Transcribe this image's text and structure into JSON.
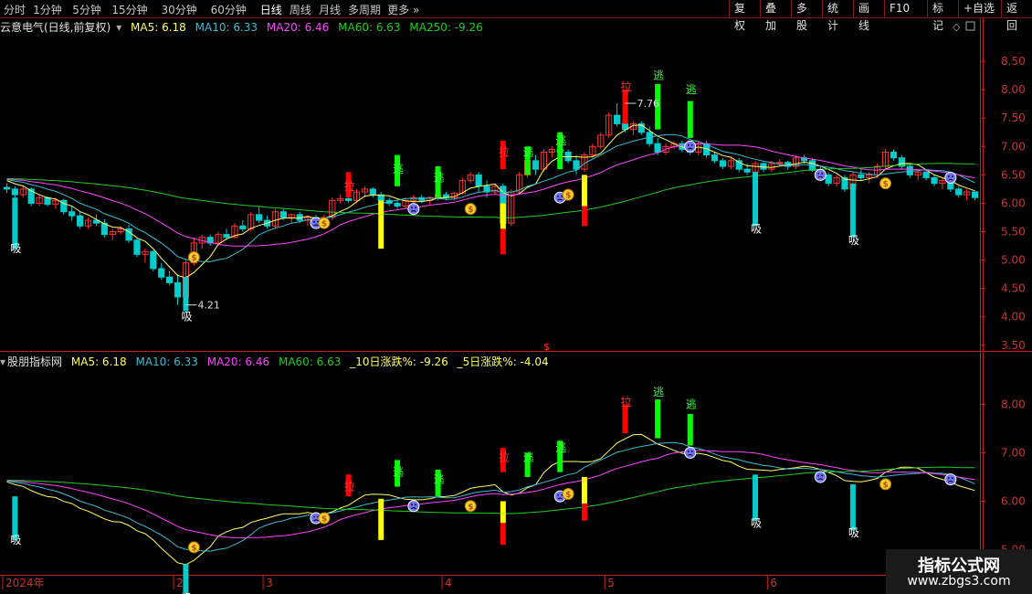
{
  "toolbar": {
    "periods": [
      "分时",
      "1分钟",
      "5分钟",
      "15分钟",
      "30分钟",
      "60分钟",
      "日线",
      "周线",
      "月线",
      "多周期",
      "更多 »"
    ],
    "active_period": "日线",
    "right_buttons": [
      "复权",
      "叠加",
      "多股",
      "统计",
      "画线",
      "F10",
      "标记",
      "+自选",
      "返回"
    ]
  },
  "main_legend": {
    "title": "云意电气(日线,前复权)",
    "ma5": "MA5: 6.18",
    "ma10": "MA10: 6.33",
    "ma20": "MA20: 6.46",
    "ma60": "MA60: 6.63",
    "ma250": "MA250: -9.26"
  },
  "sub_legend": {
    "title": "股朋指标网",
    "ma5": "MA5: 6.18",
    "ma10": "MA10: 6.33",
    "ma20": "MA20: 6.46",
    "ma60": "MA60: 6.63",
    "chg10": "_10日涨跌%: -9.26",
    "chg5": "_5日涨跌%: -4.04"
  },
  "colors": {
    "up": "#ff3232",
    "down": "#00cccc",
    "ma5": "#ffff66",
    "ma10": "#3cbcd0",
    "ma20": "#ff44ff",
    "ma60": "#22cc22",
    "axis": "#c81e1e",
    "grid": "#3a0c0c"
  },
  "watermark": {
    "title": "指标公式网",
    "url": "www.zbgs3.com"
  },
  "chart_data": [
    {
      "type": "candlestick",
      "title": "云意电气(日线,前复权)",
      "ylim": [
        3.4,
        9.0
      ],
      "yticks": [
        "3.50",
        "4.00",
        "4.50",
        "5.00",
        "5.50",
        "6.00",
        "6.50",
        "7.00",
        "7.50",
        "8.00",
        "8.50"
      ],
      "x_labels": [
        {
          "i": 0,
          "label": "2024年"
        },
        {
          "i": 21,
          "label": "2"
        },
        {
          "i": 32,
          "label": "3"
        },
        {
          "i": 54,
          "label": "4"
        },
        {
          "i": 74,
          "label": "5"
        },
        {
          "i": 94,
          "label": "6"
        }
      ],
      "annotations": [
        {
          "i": 22,
          "text": "4.21"
        },
        {
          "i": 76,
          "text": "7.76"
        }
      ],
      "candles": [
        [
          6.28,
          6.35,
          6.18,
          6.25
        ],
        [
          6.25,
          6.3,
          6.1,
          6.15
        ],
        [
          6.15,
          6.3,
          6.1,
          6.25
        ],
        [
          6.25,
          6.28,
          5.95,
          6.0
        ],
        [
          6.0,
          6.15,
          5.95,
          6.1
        ],
        [
          6.1,
          6.12,
          5.95,
          5.98
        ],
        [
          5.98,
          6.1,
          5.9,
          6.05
        ],
        [
          6.05,
          6.08,
          5.8,
          5.85
        ],
        [
          5.85,
          5.95,
          5.7,
          5.78
        ],
        [
          5.78,
          5.85,
          5.55,
          5.6
        ],
        [
          5.6,
          5.75,
          5.55,
          5.7
        ],
        [
          5.7,
          5.8,
          5.6,
          5.65
        ],
        [
          5.65,
          5.72,
          5.4,
          5.45
        ],
        [
          5.45,
          5.55,
          5.35,
          5.5
        ],
        [
          5.5,
          5.6,
          5.45,
          5.55
        ],
        [
          5.55,
          5.62,
          5.3,
          5.35
        ],
        [
          5.35,
          5.4,
          5.05,
          5.1
        ],
        [
          5.1,
          5.2,
          4.95,
          5.15
        ],
        [
          5.15,
          5.18,
          4.8,
          4.85
        ],
        [
          4.85,
          4.95,
          4.65,
          4.7
        ],
        [
          4.7,
          4.8,
          4.55,
          4.6
        ],
        [
          4.6,
          4.75,
          4.21,
          4.35
        ],
        [
          4.35,
          5.0,
          4.3,
          4.95
        ],
        [
          4.95,
          5.4,
          4.9,
          5.3
        ],
        [
          5.3,
          5.45,
          5.2,
          5.4
        ],
        [
          5.4,
          5.45,
          5.25,
          5.3
        ],
        [
          5.3,
          5.5,
          5.25,
          5.45
        ],
        [
          5.45,
          5.55,
          5.35,
          5.4
        ],
        [
          5.4,
          5.65,
          5.38,
          5.6
        ],
        [
          5.6,
          5.7,
          5.5,
          5.55
        ],
        [
          5.55,
          5.85,
          5.5,
          5.8
        ],
        [
          5.8,
          5.95,
          5.65,
          5.7
        ],
        [
          5.7,
          5.78,
          5.55,
          5.6
        ],
        [
          5.6,
          5.9,
          5.55,
          5.85
        ],
        [
          5.85,
          5.9,
          5.7,
          5.75
        ],
        [
          5.75,
          5.82,
          5.65,
          5.8
        ],
        [
          5.8,
          5.85,
          5.65,
          5.7
        ],
        [
          5.7,
          5.78,
          5.6,
          5.75
        ],
        [
          5.75,
          5.8,
          5.62,
          5.66
        ],
        [
          5.66,
          5.8,
          5.62,
          5.75
        ],
        [
          5.75,
          6.1,
          5.7,
          6.05
        ],
        [
          6.05,
          6.15,
          6.0,
          6.08
        ],
        [
          6.08,
          6.15,
          6.0,
          6.05
        ],
        [
          6.05,
          6.25,
          6.0,
          6.2
        ],
        [
          6.2,
          6.3,
          6.1,
          6.25
        ],
        [
          6.25,
          6.28,
          6.1,
          6.15
        ],
        [
          6.15,
          6.2,
          6.0,
          6.05
        ],
        [
          6.05,
          6.1,
          5.95,
          6.0
        ],
        [
          6.0,
          6.05,
          5.9,
          5.95
        ],
        [
          5.95,
          6.1,
          5.9,
          6.05
        ],
        [
          6.05,
          6.15,
          6.0,
          6.1
        ],
        [
          6.1,
          6.15,
          6.0,
          6.05
        ],
        [
          6.05,
          6.12,
          5.98,
          6.1
        ],
        [
          6.1,
          6.2,
          6.05,
          6.15
        ],
        [
          6.15,
          6.2,
          6.05,
          6.1
        ],
        [
          6.1,
          6.2,
          6.05,
          6.18
        ],
        [
          6.18,
          6.45,
          6.15,
          6.4
        ],
        [
          6.4,
          6.55,
          6.35,
          6.5
        ],
        [
          6.5,
          6.55,
          6.2,
          6.3
        ],
        [
          6.3,
          6.4,
          6.1,
          6.2
        ],
        [
          6.2,
          6.35,
          6.15,
          6.3
        ],
        [
          6.3,
          6.35,
          5.6,
          5.65
        ],
        [
          5.65,
          6.25,
          5.6,
          6.2
        ],
        [
          6.2,
          6.55,
          6.15,
          6.5
        ],
        [
          6.5,
          6.8,
          6.45,
          6.75
        ],
        [
          6.75,
          6.85,
          6.5,
          6.6
        ],
        [
          6.6,
          6.95,
          6.55,
          6.9
        ],
        [
          6.9,
          7.0,
          6.8,
          6.95
        ],
        [
          6.95,
          7.05,
          6.85,
          6.9
        ],
        [
          6.9,
          6.95,
          6.7,
          6.75
        ],
        [
          6.75,
          6.85,
          6.5,
          6.6
        ],
        [
          6.6,
          6.9,
          6.55,
          6.85
        ],
        [
          6.85,
          7.05,
          6.8,
          7.0
        ],
        [
          7.0,
          7.25,
          6.95,
          7.2
        ],
        [
          7.2,
          7.6,
          7.15,
          7.55
        ],
        [
          7.55,
          7.76,
          7.35,
          7.4
        ],
        [
          7.4,
          7.5,
          7.25,
          7.3
        ],
        [
          7.3,
          7.45,
          7.2,
          7.4
        ],
        [
          7.4,
          7.45,
          7.2,
          7.25
        ],
        [
          7.25,
          7.35,
          7.0,
          7.05
        ],
        [
          7.05,
          7.15,
          6.85,
          6.9
        ],
        [
          6.9,
          7.05,
          6.85,
          7.0
        ],
        [
          7.0,
          7.1,
          6.95,
          7.05
        ],
        [
          7.05,
          7.1,
          6.9,
          6.95
        ],
        [
          6.95,
          7.0,
          6.85,
          6.9
        ],
        [
          6.9,
          7.1,
          6.85,
          7.05
        ],
        [
          7.05,
          7.1,
          6.8,
          6.85
        ],
        [
          6.85,
          6.9,
          6.7,
          6.75
        ],
        [
          6.75,
          6.8,
          6.6,
          6.65
        ],
        [
          6.65,
          6.8,
          6.6,
          6.75
        ],
        [
          6.75,
          6.8,
          6.55,
          6.6
        ],
        [
          6.6,
          6.7,
          6.5,
          6.55
        ],
        [
          6.55,
          6.75,
          6.5,
          6.7
        ],
        [
          6.7,
          6.72,
          6.55,
          6.6
        ],
        [
          6.6,
          6.75,
          6.55,
          6.7
        ],
        [
          6.7,
          6.78,
          6.65,
          6.72
        ],
        [
          6.72,
          6.75,
          6.6,
          6.65
        ],
        [
          6.65,
          6.85,
          6.6,
          6.8
        ],
        [
          6.8,
          6.85,
          6.7,
          6.75
        ],
        [
          6.75,
          6.8,
          6.55,
          6.58
        ],
        [
          6.58,
          6.65,
          6.45,
          6.5
        ],
        [
          6.5,
          6.55,
          6.3,
          6.35
        ],
        [
          6.35,
          6.5,
          6.3,
          6.45
        ],
        [
          6.45,
          6.5,
          6.2,
          6.25
        ],
        [
          6.25,
          6.55,
          6.2,
          6.5
        ],
        [
          6.5,
          6.6,
          6.4,
          6.45
        ],
        [
          6.45,
          6.55,
          6.35,
          6.5
        ],
        [
          6.5,
          6.7,
          6.45,
          6.65
        ],
        [
          6.65,
          6.95,
          6.6,
          6.9
        ],
        [
          6.9,
          6.95,
          6.75,
          6.8
        ],
        [
          6.8,
          6.85,
          6.6,
          6.65
        ],
        [
          6.65,
          6.7,
          6.45,
          6.5
        ],
        [
          6.5,
          6.6,
          6.4,
          6.55
        ],
        [
          6.55,
          6.6,
          6.4,
          6.45
        ],
        [
          6.45,
          6.5,
          6.3,
          6.35
        ],
        [
          6.35,
          6.45,
          6.25,
          6.4
        ],
        [
          6.4,
          6.45,
          6.2,
          6.25
        ],
        [
          6.25,
          6.3,
          6.1,
          6.15
        ],
        [
          6.15,
          6.25,
          6.05,
          6.2
        ],
        [
          6.2,
          6.22,
          6.05,
          6.1
        ]
      ],
      "signals": [
        {
          "i": 1,
          "type": "吸",
          "value": 5.2
        },
        {
          "i": 22,
          "type": "吸",
          "value": 4.0
        },
        {
          "i": 23,
          "type": "money",
          "value": 5.05
        },
        {
          "i": 38,
          "type": "face",
          "value": 5.65
        },
        {
          "i": 39,
          "type": "money",
          "value": 5.65
        },
        {
          "i": 42,
          "type": "拉",
          "value": 6.3
        },
        {
          "i": 48,
          "type": "逃",
          "value": 6.6
        },
        {
          "i": 50,
          "type": "face",
          "value": 5.9
        },
        {
          "i": 53,
          "type": "逃",
          "value": 6.45
        },
        {
          "i": 57,
          "type": "money",
          "value": 5.9
        },
        {
          "i": 61,
          "type": "拉",
          "value": 6.9
        },
        {
          "i": 64,
          "type": "逃",
          "value": 6.9
        },
        {
          "i": 68,
          "type": "face",
          "value": 6.1
        },
        {
          "i": 68,
          "type": "逃",
          "value": 7.1
        },
        {
          "i": 69,
          "type": "money",
          "value": 6.15
        },
        {
          "i": 76,
          "type": "拉",
          "value": 8.05
        },
        {
          "i": 80,
          "type": "逃",
          "value": 8.25
        },
        {
          "i": 84,
          "type": "face",
          "value": 7.0
        },
        {
          "i": 84,
          "type": "逃",
          "value": 8.0
        },
        {
          "i": 92,
          "type": "吸",
          "value": 5.55
        },
        {
          "i": 100,
          "type": "face",
          "value": 6.5
        },
        {
          "i": 104,
          "type": "吸",
          "value": 5.35
        },
        {
          "i": 108,
          "type": "money",
          "value": 6.35
        },
        {
          "i": 116,
          "type": "face",
          "value": 6.45
        }
      ],
      "bars": [
        {
          "i": 1,
          "from": 6.1,
          "to": 5.2,
          "color": "#00cccc"
        },
        {
          "i": 22,
          "from": 4.7,
          "to": 4.1,
          "color": "#00cccc"
        },
        {
          "i": 42,
          "from": 6.55,
          "to": 6.1,
          "color": "#ff0000"
        },
        {
          "i": 46,
          "from": 6.05,
          "to": 5.2,
          "color": "#ffff00"
        },
        {
          "i": 48,
          "from": 6.85,
          "to": 6.3,
          "color": "#00ff00"
        },
        {
          "i": 53,
          "from": 6.65,
          "to": 6.1,
          "color": "#00ff00"
        },
        {
          "i": 61,
          "from": 7.1,
          "to": 6.6,
          "color": "#ff0000"
        },
        {
          "i": 61,
          "from": 6.0,
          "to": 5.55,
          "color": "#ffff00"
        },
        {
          "i": 61,
          "from": 5.55,
          "to": 5.1,
          "color": "#ff0000"
        },
        {
          "i": 64,
          "from": 7.0,
          "to": 6.5,
          "color": "#00ff00"
        },
        {
          "i": 68,
          "from": 7.25,
          "to": 6.6,
          "color": "#00ff00"
        },
        {
          "i": 71,
          "from": 6.5,
          "to": 5.95,
          "color": "#ffff00"
        },
        {
          "i": 71,
          "from": 5.95,
          "to": 5.6,
          "color": "#ff0000"
        },
        {
          "i": 76,
          "from": 8.0,
          "to": 7.4,
          "color": "#ff0000"
        },
        {
          "i": 80,
          "from": 8.1,
          "to": 7.3,
          "color": "#00ff00"
        },
        {
          "i": 84,
          "from": 7.8,
          "to": 7.15,
          "color": "#00ff00"
        },
        {
          "i": 92,
          "from": 6.55,
          "to": 5.6,
          "color": "#00cccc"
        },
        {
          "i": 104,
          "from": 6.35,
          "to": 5.4,
          "color": "#00cccc"
        }
      ]
    },
    {
      "type": "line",
      "title": "股朋指标网",
      "ylim": [
        4.5,
        8.8
      ],
      "yticks": [
        "5.00",
        "6.00",
        "7.00",
        "8.00"
      ],
      "series_names": [
        "MA5",
        "MA10",
        "MA20",
        "MA60"
      ]
    }
  ]
}
